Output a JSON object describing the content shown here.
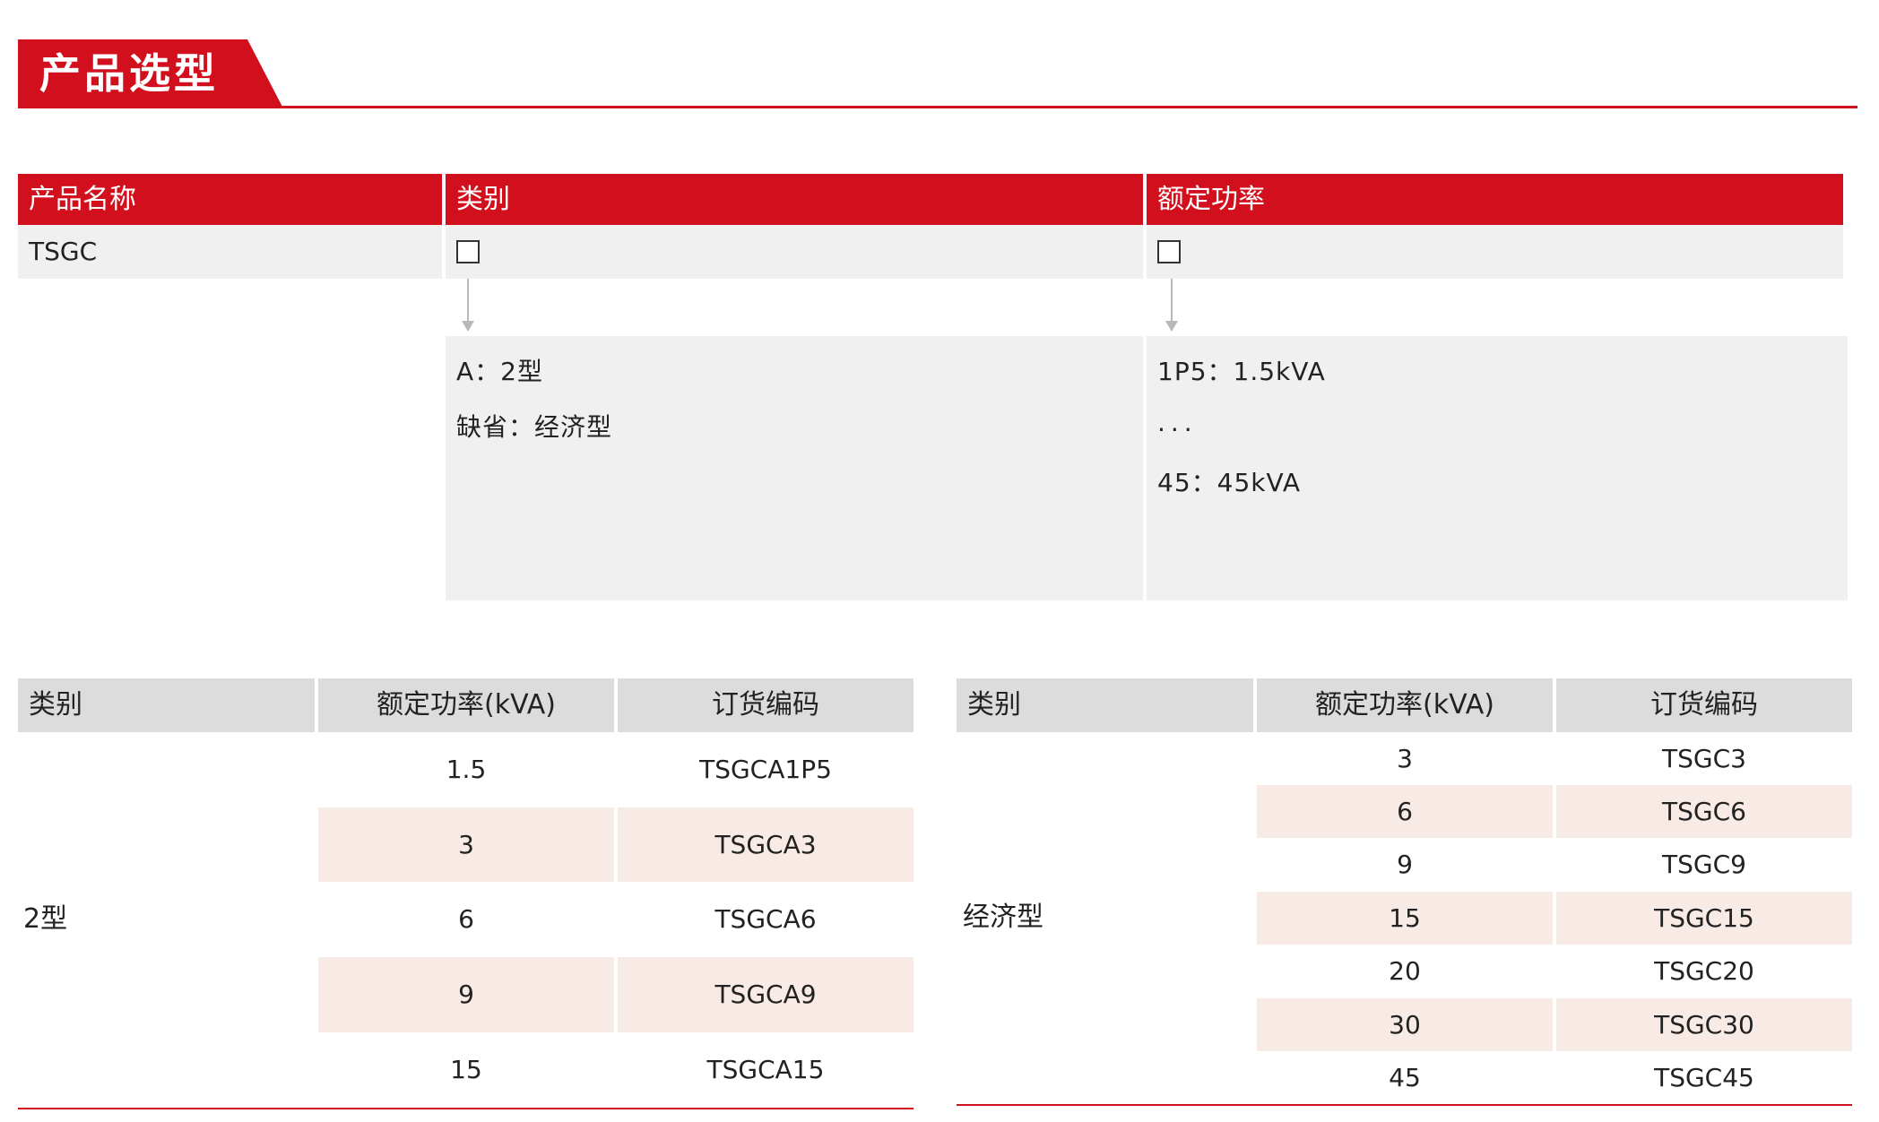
{
  "header": {
    "title": "产品选型"
  },
  "selection": {
    "columns": [
      "产品名称",
      "类别",
      "额定功率"
    ],
    "product_name": "TSGC",
    "category_options": [
      "A：2型",
      "缺省：经济型"
    ],
    "power_options": [
      "1P5：1.5kVA",
      "...",
      "45：45kVA"
    ]
  },
  "table_a": {
    "headers": [
      "类别",
      "额定功率(kVA)",
      "订货编码"
    ],
    "category": "2型",
    "rows": [
      {
        "power": "1.5",
        "code": "TSGCA1P5"
      },
      {
        "power": "3",
        "code": "TSGCA3"
      },
      {
        "power": "6",
        "code": "TSGCA6"
      },
      {
        "power": "9",
        "code": "TSGCA9"
      },
      {
        "power": "15",
        "code": "TSGCA15"
      }
    ]
  },
  "table_b": {
    "headers": [
      "类别",
      "额定功率(kVA)",
      "订货编码"
    ],
    "category": "经济型",
    "rows": [
      {
        "power": "3",
        "code": "TSGC3"
      },
      {
        "power": "6",
        "code": "TSGC6"
      },
      {
        "power": "9",
        "code": "TSGC9"
      },
      {
        "power": "15",
        "code": "TSGC15"
      },
      {
        "power": "20",
        "code": "TSGC20"
      },
      {
        "power": "30",
        "code": "TSGC30"
      },
      {
        "power": "45",
        "code": "TSGC45"
      }
    ]
  },
  "colors": {
    "accent": "#d10f1d",
    "stripe": "#f8ebe6",
    "header_gray": "#dcdcdc",
    "panel_gray": "#f0f0f0"
  }
}
